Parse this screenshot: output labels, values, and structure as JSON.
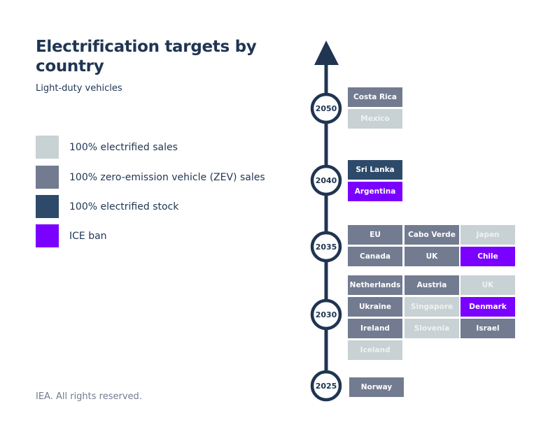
{
  "header": {
    "title": "Electrification targets by country",
    "subtitle": "Light-duty vehicles"
  },
  "legend": [
    {
      "key": "electrified_sales",
      "label": "100% electrified sales",
      "color": "#c8d1d3"
    },
    {
      "key": "zev_sales",
      "label": "100% zero-emission vehicle (ZEV) sales",
      "color": "#737b91"
    },
    {
      "key": "electrified_stock",
      "label": "100% electrified stock",
      "color": "#2e4a6a"
    },
    {
      "key": "ice_ban",
      "label": "ICE ban",
      "color": "#7a00ff"
    }
  ],
  "footer": "IEA. All rights reserved.",
  "timeline_color": "#1f3552",
  "chart_data": {
    "type": "table",
    "title": "Electrification targets by country",
    "subtitle": "Light-duty vehicles",
    "years": [
      {
        "year": "2050",
        "targets": [
          {
            "country": "Costa Rica",
            "category": "zev_sales"
          },
          {
            "country": "Mexico",
            "category": "electrified_sales"
          }
        ]
      },
      {
        "year": "2040",
        "targets": [
          {
            "country": "Sri Lanka",
            "category": "electrified_stock"
          },
          {
            "country": "Argentina",
            "category": "ice_ban"
          }
        ]
      },
      {
        "year": "2035",
        "targets": [
          {
            "country": "EU",
            "category": "zev_sales"
          },
          {
            "country": "Cabo Verde",
            "category": "zev_sales"
          },
          {
            "country": "Japan",
            "category": "electrified_sales"
          },
          {
            "country": "Canada",
            "category": "zev_sales"
          },
          {
            "country": "UK",
            "category": "zev_sales"
          },
          {
            "country": "Chile",
            "category": "ice_ban"
          }
        ]
      },
      {
        "year": "2030",
        "targets": [
          {
            "country": "Netherlands",
            "category": "zev_sales"
          },
          {
            "country": "Austria",
            "category": "zev_sales"
          },
          {
            "country": "UK",
            "category": "electrified_sales"
          },
          {
            "country": "Ukraine",
            "category": "zev_sales"
          },
          {
            "country": "Singapore",
            "category": "electrified_sales"
          },
          {
            "country": "Denmark",
            "category": "ice_ban"
          },
          {
            "country": "Ireland",
            "category": "zev_sales"
          },
          {
            "country": "Slovenia",
            "category": "electrified_sales"
          },
          {
            "country": "Israel",
            "category": "zev_sales"
          },
          {
            "country": "Iceland",
            "category": "electrified_sales"
          }
        ]
      },
      {
        "year": "2025",
        "targets": [
          {
            "country": "Norway",
            "category": "zev_sales"
          }
        ]
      }
    ]
  }
}
